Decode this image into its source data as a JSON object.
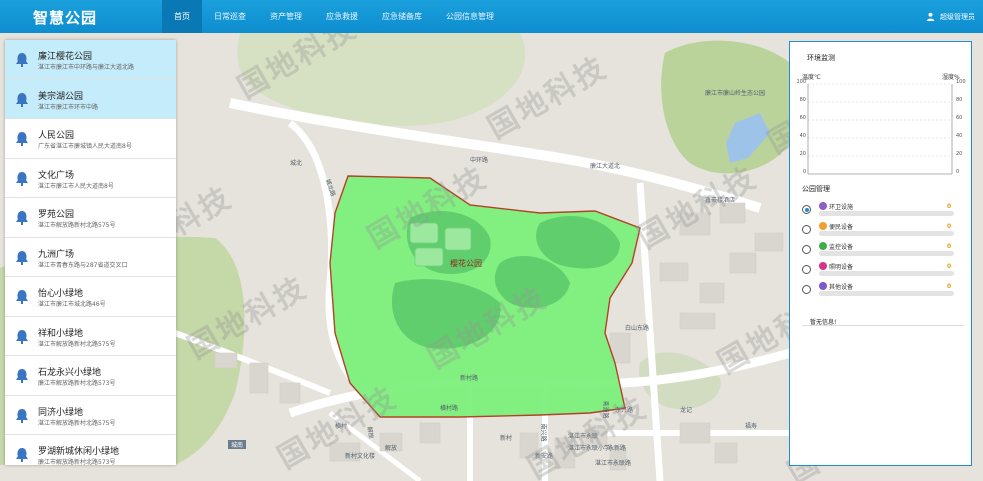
{
  "header": {
    "logo": "智慧公园",
    "nav": [
      {
        "label": "首页",
        "active": true
      },
      {
        "label": "日常巡查",
        "active": false
      },
      {
        "label": "资产管理",
        "active": false
      },
      {
        "label": "应急救援",
        "active": false
      },
      {
        "label": "应急储备库",
        "active": false
      },
      {
        "label": "公园信息管理",
        "active": false
      }
    ],
    "user": "超级管理员"
  },
  "parks": [
    {
      "name": "廉江樱花公园",
      "address": "湛江市廉江市中环路与廉江大道北路"
    },
    {
      "name": "美宗湖公园",
      "address": "湛江市廉江市环市中路"
    },
    {
      "name": "人民公园",
      "address": "广东省湛江市廉城镇人民大道南8号"
    },
    {
      "name": "文化广场",
      "address": "湛江市廉江市人民大道南8号"
    },
    {
      "name": "罗苑公园",
      "address": "湛江市解放路新村北路575号"
    },
    {
      "name": "九洲广场",
      "address": "湛江市青春东路与287省道交叉口"
    },
    {
      "name": "怡心小绿地",
      "address": "湛江市廉江市城北路46号"
    },
    {
      "name": "祥和小绿地",
      "address": "湛江市解放路新村北路575号"
    },
    {
      "name": "石龙永兴小绿地",
      "address": "廉江市解放路新村北路573号"
    },
    {
      "name": "同济小绿地",
      "address": "湛江市解放路新村北路575号"
    },
    {
      "name": "罗湖新城休闲小绿地",
      "address": "廉江市解放路新村北路573号"
    }
  ],
  "env": {
    "title": "环境监测",
    "left_unit": "温度℃",
    "right_unit": "湿度%",
    "ticks": [
      "100",
      "80",
      "60",
      "40",
      "20",
      "0"
    ]
  },
  "management": {
    "title": "公园管理",
    "items": [
      {
        "label": "环卫设施",
        "count": "0",
        "color": "#8b5fc7",
        "checked": true
      },
      {
        "label": "便民设备",
        "count": "0",
        "color": "#f0a030",
        "checked": false
      },
      {
        "label": "监控设备",
        "count": "0",
        "color": "#3fae4a",
        "checked": false
      },
      {
        "label": "照明设备",
        "count": "0",
        "color": "#d6338c",
        "checked": false
      },
      {
        "label": "其他设备",
        "count": "0",
        "color": "#7b5ad0",
        "checked": false
      }
    ],
    "no_info": "暂无信息!"
  },
  "map": {
    "polygon_label": "樱花公园",
    "labels": [
      "廉江市廉山岭生态公园",
      "鑫豪楼酒店",
      "白山东路",
      "城北路",
      "新村路",
      "横村路",
      "湛江市永联",
      "湛江市永联小学",
      "城南",
      "新村文化楼",
      "新安路",
      "青源路",
      "横村",
      "南兴路",
      "解放",
      "东兴路",
      "新村",
      "龙记",
      "福寿",
      "永新路",
      "湛江市永联路",
      "解放",
      "城北",
      "廉江大道北",
      "中环路"
    ],
    "watermark": "国地科技"
  }
}
